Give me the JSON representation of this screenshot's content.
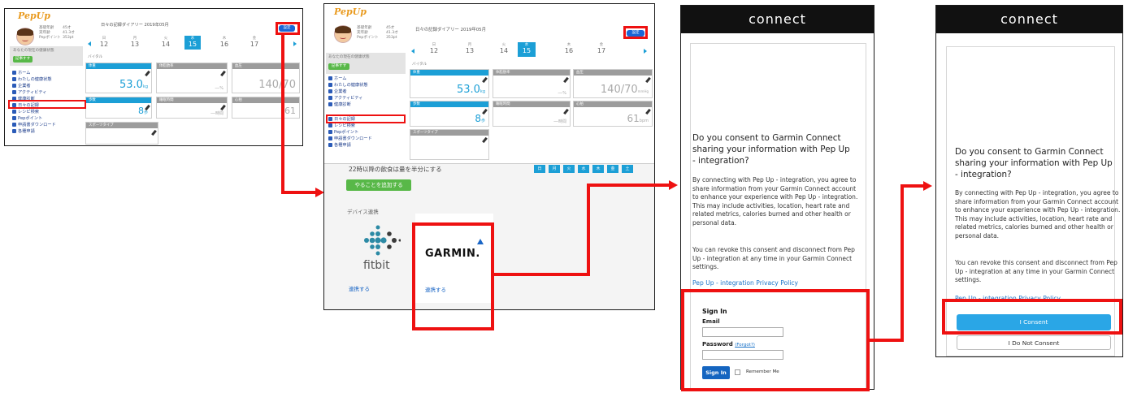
{
  "shot1": {
    "logo": "PepUp",
    "profile_lines": [
      "基礎年齢",
      "実年齢",
      "Pepポイント"
    ],
    "profile_values": [
      "45才",
      "41.3才",
      "353pt"
    ],
    "diary_title": "日々の記録ダイアリー 2019年05月",
    "settings_label": "設定",
    "dates": [
      {
        "dow": "日",
        "num": "12"
      },
      {
        "dow": "月",
        "num": "13"
      },
      {
        "dow": "火",
        "num": "14"
      },
      {
        "dow": "水",
        "num": "15"
      },
      {
        "dow": "木",
        "num": "16"
      },
      {
        "dow": "金",
        "num": "17"
      }
    ],
    "health_status_label": "あなたの現在の健康状態",
    "green_pill": "記事すす",
    "vitals_label": "バイタル",
    "nav_items": [
      "ホーム",
      "わたしの健康状態",
      "企業者",
      "アクティビティ",
      "健康診断",
      "日々の記録",
      "レシピ検索",
      "Pepポイント",
      "申請書ダウンロード",
      "各種申請"
    ],
    "cards": [
      {
        "title": "体重",
        "value": "53.0",
        "unit": "kg"
      },
      {
        "title": "体脂肪率",
        "value": "—",
        "unit": "%"
      },
      {
        "title": "血圧",
        "value": "140/70",
        "unit": "mmHg"
      },
      {
        "title": "歩数",
        "value": "8",
        "unit": "歩"
      },
      {
        "title": "睡眠時間",
        "value": "—",
        "unit": "時間"
      },
      {
        "title": "心拍",
        "value": "61",
        "unit": "bpm"
      }
    ],
    "sport_label": "スポーツタイプ"
  },
  "shot2": {
    "habit_text": "22時以降の飲食は量を半分にする",
    "weekdays": [
      "日",
      "月",
      "火",
      "水",
      "木",
      "金",
      "土"
    ],
    "add_button": "やることを追加する",
    "device_label": "デバイス連携",
    "fitbit_label": "fitbit",
    "fitbit_connect": "連携する",
    "garmin_label": "GARMIN.",
    "garmin_connect": "連携する"
  },
  "panel3": {
    "header": "connect",
    "title": "Do you consent to Garmin Connect sharing your information with Pep Up - integration?",
    "para1": "By connecting with Pep Up - integration, you agree to share information from your Garmin Connect account to enhance your experience with Pep Up - integration. This may include activities, location, heart rate and related metrics, calories burned and other health or personal data.",
    "para2": "You can revoke this consent and disconnect from Pep Up - integration at any time in your Garmin Connect settings.",
    "privacy_link": "Pep Up - integration Privacy Policy",
    "signin_title": "Sign In",
    "email_label": "Email",
    "password_label": "Password",
    "forgot_link": "(Forgot?)",
    "signin_button": "Sign In",
    "remember_label": "Remember Me"
  },
  "panel4": {
    "header": "connect",
    "title": "Do you consent to Garmin Connect sharing your information with Pep Up - integration?",
    "para1": "By connecting with Pep Up - integration, you agree to share information from your Garmin Connect account to enhance your experience with Pep Up - integration. This may include activities, location, heart rate and related metrics, calories burned and other health or personal data.",
    "para2": "You can revoke this consent and disconnect from Pep Up - integration at any time in your Garmin Connect settings.",
    "privacy_link": "Pep Up - integration Privacy Policy",
    "consent_button": "I Consent",
    "decline_button": "I Do Not Consent"
  },
  "colors": {
    "annotation_red": "#ee1111",
    "pepup_blue": "#1c9fd6",
    "garmin_button_blue": "#2aa6e6",
    "pepup_green": "#58b848"
  }
}
